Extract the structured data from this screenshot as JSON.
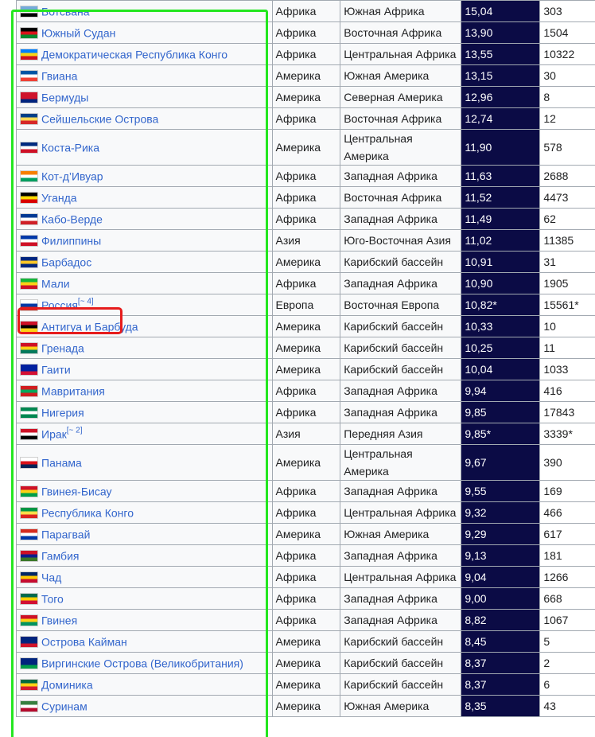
{
  "rows": [
    {
      "country": "Ботсвана",
      "region": "Африка",
      "subregion": "Южная Африка",
      "rate": "15,04",
      "population": "303",
      "flag": [
        "#75aadb",
        "#ffffff",
        "#000000"
      ]
    },
    {
      "country": "Южный Судан",
      "region": "Африка",
      "subregion": "Восточная Африка",
      "rate": "13,90",
      "population": "1504",
      "flag": [
        "#000000",
        "#da121a",
        "#078930"
      ]
    },
    {
      "country": "Демократическая Республика Конго",
      "region": "Африка",
      "subregion": "Центральная Африка",
      "rate": "13,55",
      "population": "10322",
      "flag": [
        "#007fff",
        "#f7d618",
        "#ce1021"
      ]
    },
    {
      "country": "Гвиана",
      "region": "Америка",
      "subregion": "Южная Америка",
      "rate": "13,15",
      "population": "30",
      "flag": [
        "#0055a4",
        "#ffffff",
        "#ef4135"
      ]
    },
    {
      "country": "Бермуды",
      "region": "Америка",
      "subregion": "Северная Америка",
      "rate": "12,96",
      "population": "8",
      "flag": [
        "#cf142b",
        "#cf142b",
        "#00247d"
      ]
    },
    {
      "country": "Сейшельские Острова",
      "region": "Африка",
      "subregion": "Восточная Африка",
      "rate": "12,74",
      "population": "12",
      "flag": [
        "#003f87",
        "#fcd856",
        "#d62828"
      ]
    },
    {
      "country": "Коста-Рика",
      "region": "Америка",
      "subregion": "Центральная Америка",
      "rate": "11,90",
      "population": "578",
      "flag": [
        "#002b7f",
        "#ffffff",
        "#ce1126"
      ],
      "tall": true
    },
    {
      "country": "Кот-д’Ивуар",
      "region": "Африка",
      "subregion": "Западная Африка",
      "rate": "11,63",
      "population": "2688",
      "flag": [
        "#f77f00",
        "#ffffff",
        "#009e60"
      ]
    },
    {
      "country": "Уганда",
      "region": "Африка",
      "subregion": "Восточная Африка",
      "rate": "11,52",
      "population": "4473",
      "flag": [
        "#000000",
        "#fcdc04",
        "#d90000"
      ]
    },
    {
      "country": "Кабо-Верде",
      "region": "Африка",
      "subregion": "Западная Африка",
      "rate": "11,49",
      "population": "62",
      "flag": [
        "#003893",
        "#ffffff",
        "#cf2027"
      ]
    },
    {
      "country": "Филиппины",
      "region": "Азия",
      "subregion": "Юго-Восточная Азия",
      "rate": "11,02",
      "population": "11385",
      "flag": [
        "#0038a8",
        "#ffffff",
        "#ce1126"
      ]
    },
    {
      "country": "Барбадос",
      "region": "Америка",
      "subregion": "Карибский бассейн",
      "rate": "10,91",
      "population": "31",
      "flag": [
        "#00267f",
        "#ffc726",
        "#00267f"
      ]
    },
    {
      "country": "Мали",
      "region": "Африка",
      "subregion": "Западная Африка",
      "rate": "10,90",
      "population": "1905",
      "flag": [
        "#14b53a",
        "#fcd116",
        "#ce1126"
      ]
    },
    {
      "country": "Россия",
      "ref": "[~ 4]",
      "region": "Европа",
      "subregion": "Восточная Европа",
      "rate": "10,82*",
      "population": "15561*",
      "flag": [
        "#ffffff",
        "#0039a6",
        "#d52b1e"
      ]
    },
    {
      "country": "Антигуа и Барбуда",
      "region": "Америка",
      "subregion": "Карибский бассейн",
      "rate": "10,33",
      "population": "10",
      "flag": [
        "#ce1126",
        "#000000",
        "#fcd116"
      ]
    },
    {
      "country": "Гренада",
      "region": "Америка",
      "subregion": "Карибский бассейн",
      "rate": "10,25",
      "population": "11",
      "flag": [
        "#ce1126",
        "#fcd116",
        "#007a5e"
      ]
    },
    {
      "country": "Гаити",
      "region": "Америка",
      "subregion": "Карибский бассейн",
      "rate": "10,04",
      "population": "1033",
      "flag": [
        "#00209f",
        "#00209f",
        "#d21034"
      ]
    },
    {
      "country": "Мавритания",
      "region": "Африка",
      "subregion": "Западная Африка",
      "rate": "9,94",
      "population": "416",
      "flag": [
        "#d01c1f",
        "#00a95c",
        "#d01c1f"
      ]
    },
    {
      "country": "Нигерия",
      "region": "Африка",
      "subregion": "Западная Африка",
      "rate": "9,85",
      "population": "17843",
      "flag": [
        "#008751",
        "#ffffff",
        "#008751"
      ]
    },
    {
      "country": "Ирак",
      "ref": "[~ 2]",
      "region": "Азия",
      "subregion": "Передняя Азия",
      "rate": "9,85*",
      "population": "3339*",
      "flag": [
        "#ce1126",
        "#ffffff",
        "#000000"
      ]
    },
    {
      "country": "Панама",
      "region": "Америка",
      "subregion": "Центральная Америка",
      "rate": "9,67",
      "population": "390",
      "flag": [
        "#ffffff",
        "#da121a",
        "#072357"
      ],
      "tall": true
    },
    {
      "country": "Гвинея-Бисау",
      "region": "Африка",
      "subregion": "Западная Африка",
      "rate": "9,55",
      "population": "169",
      "flag": [
        "#ce1126",
        "#fcd116",
        "#009e49"
      ]
    },
    {
      "country": "Республика Конго",
      "region": "Африка",
      "subregion": "Центральная Африка",
      "rate": "9,32",
      "population": "466",
      "flag": [
        "#009543",
        "#fbde4a",
        "#dc241f"
      ]
    },
    {
      "country": "Парагвай",
      "region": "Америка",
      "subregion": "Южная Америка",
      "rate": "9,29",
      "population": "617",
      "flag": [
        "#d52b1e",
        "#ffffff",
        "#0038a8"
      ]
    },
    {
      "country": "Гамбия",
      "region": "Африка",
      "subregion": "Западная Африка",
      "rate": "9,13",
      "population": "181",
      "flag": [
        "#ce1126",
        "#0c1c8c",
        "#3a7728"
      ]
    },
    {
      "country": "Чад",
      "region": "Африка",
      "subregion": "Центральная Африка",
      "rate": "9,04",
      "population": "1266",
      "flag": [
        "#002664",
        "#fecb00",
        "#c60c30"
      ]
    },
    {
      "country": "Того",
      "region": "Африка",
      "subregion": "Западная Африка",
      "rate": "9,00",
      "population": "668",
      "flag": [
        "#006a4e",
        "#ffce00",
        "#d21034"
      ]
    },
    {
      "country": "Гвинея",
      "region": "Африка",
      "subregion": "Западная Африка",
      "rate": "8,82",
      "population": "1067",
      "flag": [
        "#ce1126",
        "#fcd116",
        "#009460"
      ]
    },
    {
      "country": "Острова Кайман",
      "region": "Америка",
      "subregion": "Карибский бассейн",
      "rate": "8,45",
      "population": "5",
      "flag": [
        "#00247d",
        "#00247d",
        "#cf142b"
      ]
    },
    {
      "country": "Виргинские Острова (Великобритания)",
      "region": "Америка",
      "subregion": "Карибский бассейн",
      "rate": "8,37",
      "population": "2",
      "flag": [
        "#00247d",
        "#00247d",
        "#009e49"
      ]
    },
    {
      "country": "Доминика",
      "region": "Америка",
      "subregion": "Карибский бассейн",
      "rate": "8,37",
      "population": "6",
      "flag": [
        "#006b3f",
        "#fcd116",
        "#d41c30"
      ]
    },
    {
      "country": "Суринам",
      "region": "Америка",
      "subregion": "Южная Америка",
      "rate": "8,35",
      "population": "43",
      "flag": [
        "#377e3f",
        "#ffffff",
        "#b40a2d"
      ]
    }
  ],
  "colors": {
    "highlight_green": "#23e61f",
    "highlight_red": "#e61c1c",
    "rate_column_bg": "#0b0b45",
    "link": "#3366cc"
  }
}
